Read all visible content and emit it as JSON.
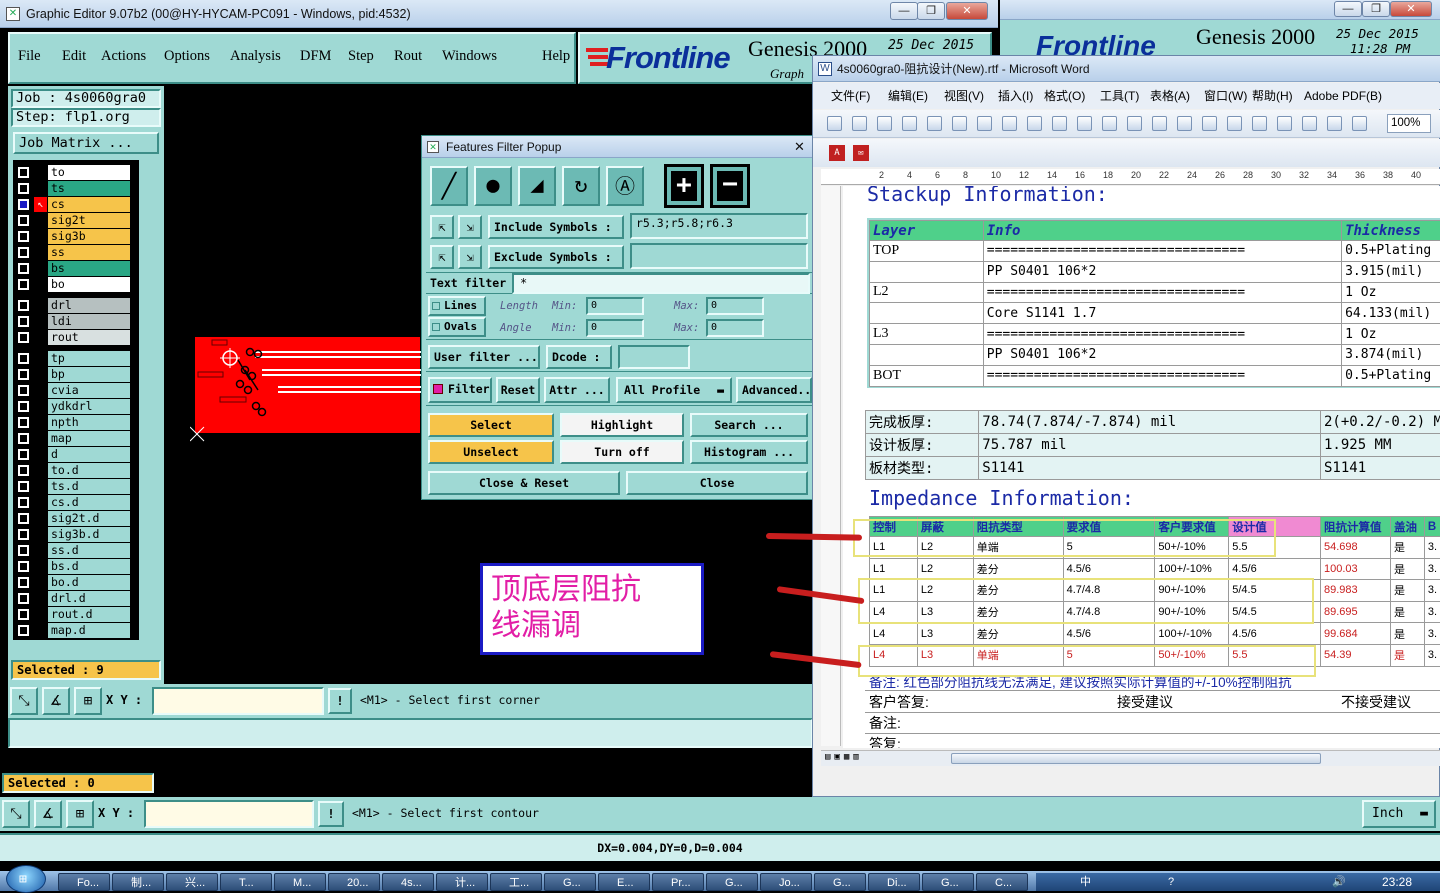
{
  "ge": {
    "title": "Graphic Editor 9.07b2 (00@HY-HYCAM-PC091 - Windows, pid:4532)",
    "menu": [
      "File",
      "Edit",
      "Actions",
      "Options",
      "Analysis",
      "DFM",
      "Step",
      "Rout",
      "Windows",
      "Help"
    ],
    "brand": "Frontline",
    "product": "Genesis 2000",
    "date": "25 Dec 2015",
    "time": "11:28 PM",
    "subtitle": "Graph",
    "job": "Job : 4s0060gra0",
    "step": "Step: flp1.org",
    "job_matrix": "Job Matrix ...",
    "layers1": [
      {
        "n": "to",
        "c": "#ffffff"
      },
      {
        "n": "ts",
        "c": "#2aa785"
      },
      {
        "n": "cs",
        "c": "#f6c44a"
      },
      {
        "n": "sig2t",
        "c": "#f6c44a"
      },
      {
        "n": "sig3b",
        "c": "#f6c44a"
      },
      {
        "n": "ss",
        "c": "#f6c44a"
      },
      {
        "n": "bs",
        "c": "#2aa785"
      },
      {
        "n": "bo",
        "c": "#ffffff"
      }
    ],
    "layers2": [
      {
        "n": "drl",
        "c": "#b6c0c0"
      },
      {
        "n": "ldi",
        "c": "#b6c0c0"
      },
      {
        "n": "rout",
        "c": "#d8e0e0"
      }
    ],
    "layers3": [
      "tp",
      "bp",
      "cvia",
      "ydkdrl",
      "npth",
      "map",
      "d",
      "to.d",
      "ts.d",
      "cs.d",
      "sig2t.d",
      "sig3b.d",
      "ss.d",
      "bs.d",
      "bo.d",
      "drl.d",
      "rout.d",
      "map.d"
    ],
    "selected1": "Selected : 9",
    "selected2": "Selected : 0",
    "xy": "X Y :",
    "prompt1": "<M1> - Select first corner",
    "prompt2": "<M1> - Select first contour",
    "units": "Inch",
    "status": "DX=0.004,DY=0,D=0.004",
    "note": [
      "顶底层阻抗",
      "线漏调"
    ],
    "colors": {
      "teal": "#9fd9d4",
      "yellow": "#f6c44a",
      "red": "#ff0000"
    }
  },
  "ffp": {
    "title": "Features Filter Popup",
    "include_label": "Include Symbols :",
    "include_value": "r5.3;r5.8;r6.3",
    "exclude_label": "Exclude Symbols :",
    "text_filter": "Text filter",
    "text_value": "*",
    "lines": "Lines",
    "ovals": "Ovals",
    "length": "Length",
    "angle": "Angle",
    "min": "Min:",
    "max": "Max:",
    "zero": "0",
    "user_filter": "User filter ...",
    "dcode": "Dcode :",
    "filter": "Filter",
    "reset": "Reset",
    "attr": "Attr ...",
    "all_profile": "All Profile",
    "advanced": "Advanced...",
    "select": "Select",
    "highlight": "Highlight",
    "search": "Search ...",
    "unselect": "Unselect",
    "turn_off": "Turn off",
    "histogram": "Histogram ...",
    "close_reset": "Close & Reset",
    "close": "Close"
  },
  "word": {
    "title": "4s0060gra0-阻抗设计(New).rtf - Microsoft Word",
    "menu": [
      "文件(F)",
      "编辑(E)",
      "视图(V)",
      "插入(I)",
      "格式(O)",
      "工具(T)",
      "表格(A)",
      "窗口(W)",
      "帮助(H)",
      "Adobe PDF(B)"
    ],
    "zoom": "100%",
    "ruler": [
      "2",
      "4",
      "6",
      "8",
      "10",
      "12",
      "14",
      "16",
      "18",
      "20",
      "22",
      "24",
      "26",
      "28",
      "30",
      "32",
      "34",
      "36",
      "38",
      "40"
    ],
    "stackup_heading": "Stackup Information:",
    "stack_head": [
      "Layer",
      "Info",
      "Thickness"
    ],
    "stack_rows": [
      [
        "TOP",
        "=================================",
        "0.5+Plating"
      ],
      [
        "",
        "PP    S0401    106*2",
        "3.915(mil)"
      ],
      [
        "L2",
        "=================================",
        "1 Oz"
      ],
      [
        "",
        "Core    S1141    1.7",
        "64.133(mil)"
      ],
      [
        "L3",
        "=================================",
        "1 Oz"
      ],
      [
        "",
        "PP    S0401    106*2",
        "3.874(mil)"
      ],
      [
        "BOT",
        "=================================",
        "0.5+Plating"
      ]
    ],
    "thick_rows": [
      [
        "完成板厚:",
        "78.74(7.874/-7.874) mil",
        "2(+0.2/-0.2) MM"
      ],
      [
        "设计板厚:",
        "75.787 mil",
        "1.925 MM"
      ],
      [
        "板材类型:",
        "S1141",
        "S1141"
      ]
    ],
    "impedance_heading": "Impedance Information:",
    "imp_head": [
      "控制",
      "屏蔽",
      "阻抗类型",
      "要求值",
      "客户要求值",
      "设计值",
      "阻抗计算值",
      "盖油",
      "B"
    ],
    "imp_rows": [
      [
        "L1",
        "L2",
        "单端",
        "5",
        "50+/-10%",
        "5.5",
        "54.698",
        "是",
        "3."
      ],
      [
        "L1",
        "L2",
        "差分",
        "4.5/6",
        "100+/-10%",
        "4.5/6",
        "100.03",
        "是",
        "3."
      ],
      [
        "L1",
        "L2",
        "差分",
        "4.7/4.8",
        "90+/-10%",
        "5/4.5",
        "89.983",
        "是",
        "3."
      ],
      [
        "L4",
        "L3",
        "差分",
        "4.7/4.8",
        "90+/-10%",
        "5/4.5",
        "89.695",
        "是",
        "3."
      ],
      [
        "L4",
        "L3",
        "差分",
        "4.5/6",
        "100+/-10%",
        "4.5/6",
        "99.684",
        "是",
        "3."
      ],
      [
        "L4",
        "L3",
        "单端",
        "5",
        "50+/-10%",
        "5.5",
        "54.39",
        "是",
        "3."
      ]
    ],
    "remark": "备注: 红色部分阻抗线无法满足, 建议按照实际计算值的+/-10%控制阻抗",
    "reply_label": "客户答复:",
    "accept": "接受建议",
    "reject": "不接受建议",
    "remark2": "备注:",
    "reply2": "答复:"
  },
  "bg_window": {
    "product": "Genesis 2000",
    "date": "25 Dec 2015",
    "time": "11:28 PM",
    "subtitle": "Graphic Editor"
  },
  "taskbar": {
    "items": [
      "Fo...",
      "制...",
      "兴...",
      "T...",
      "M...",
      "20...",
      "4s...",
      "计...",
      "工...",
      "G...",
      "E...",
      "Pr...",
      "G...",
      "Jo...",
      "G...",
      "Di...",
      "G...",
      "C..."
    ],
    "ime": "中",
    "clock": "23:28"
  }
}
